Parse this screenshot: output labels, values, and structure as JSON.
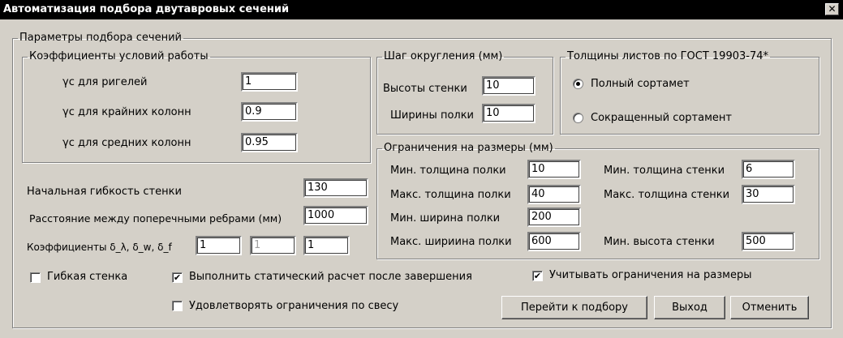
{
  "window": {
    "title": "Автоматизация подбора двутавровых сечений",
    "close_glyph": "✕"
  },
  "main_group": {
    "legend": "Параметры подбора сечений"
  },
  "work_coeffs": {
    "legend": "Коэффициенты условий работы",
    "rows": [
      {
        "label": "γс для ригелей",
        "value": "1"
      },
      {
        "label": "γс для крайних колонн",
        "value": "0.9"
      },
      {
        "label": "γс для средних колонн",
        "value": "0.95"
      }
    ]
  },
  "rounding": {
    "legend": "Шаг округления (мм)",
    "web_height_label": "Высоты стенки",
    "web_height_value": "10",
    "flange_width_label": "Ширины полки",
    "flange_width_value": "10"
  },
  "thickness": {
    "legend": "Толщины листов по ГОСТ 19903-74*",
    "full_label": "Полный сортамет",
    "short_label": "Сокращенный сортамент",
    "selected": "full"
  },
  "limits": {
    "legend": "Ограничения на размеры (мм)",
    "min_flange_thickness_label": "Мин. толщина полки",
    "min_flange_thickness_value": "10",
    "max_flange_thickness_label": "Макс. толщина полки",
    "max_flange_thickness_value": "40",
    "min_flange_width_label": "Мин. ширина полки",
    "min_flange_width_value": "200",
    "max_flange_width_label": "Макс. шириина полки",
    "max_flange_width_value": "600",
    "min_web_thickness_label": "Мин. толщина стенки",
    "min_web_thickness_value": "6",
    "max_web_thickness_label": "Макс. толщина стенки",
    "max_web_thickness_value": "30",
    "min_web_height_label": "Мин. высота стенки",
    "min_web_height_value": "500"
  },
  "general": {
    "initial_slenderness_label": "Начальная гибкость стенки",
    "initial_slenderness_value": "130",
    "rib_spacing_label": "Расстояние между поперечными ребрами (мм)",
    "rib_spacing_value": "1000",
    "coeffs_label": "Коэффициенты  δ_λ, δ_w, δ_f",
    "coeff_1": "1",
    "coeff_2": "1",
    "coeff_3": "1"
  },
  "options": {
    "flexible_web_label": "Гибкая стенка",
    "flexible_web_checked": false,
    "static_calc_label": "Выполнить статический расчет после завершения",
    "static_calc_checked": true,
    "weight_limits_label": "Удовлетворять ограничения по свесу",
    "weight_limits_checked": false,
    "size_limits_label": "Учитывать ограничения на размеры",
    "size_limits_checked": true
  },
  "buttons": {
    "go": "Перейти к подбору",
    "exit": "Выход",
    "cancel": "Отменить"
  },
  "check_glyph": "✔"
}
